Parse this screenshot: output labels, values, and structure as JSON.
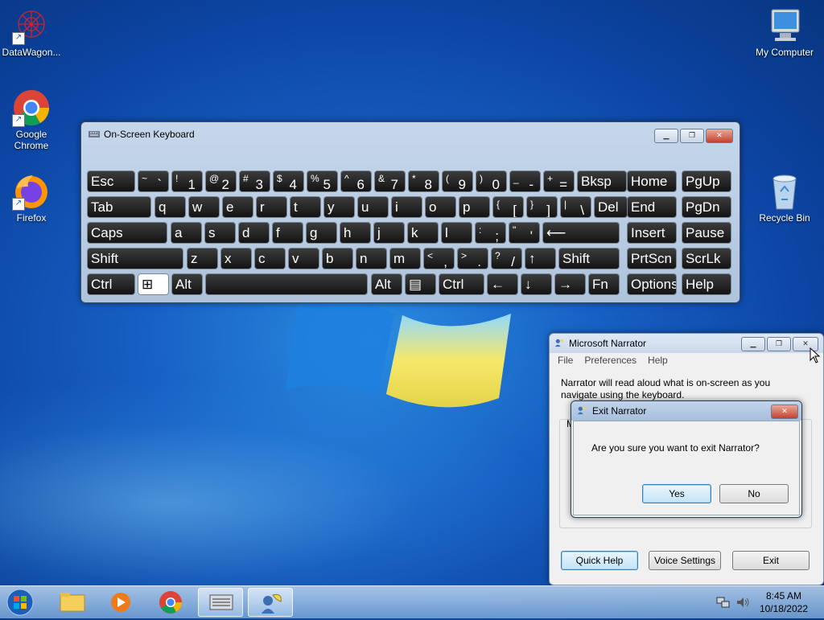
{
  "desktop": {
    "icons": [
      {
        "label": "DataWagon..."
      },
      {
        "label": "Google Chrome"
      },
      {
        "label": "Firefox"
      },
      {
        "label": "My Computer"
      },
      {
        "label": "Recycle Bin"
      }
    ]
  },
  "osk": {
    "title": "On-Screen Keyboard",
    "keys": {
      "esc": "Esc",
      "tab": "Tab",
      "caps": "Caps",
      "shift": "Shift",
      "ctrl": "Ctrl",
      "alt": "Alt",
      "bksp": "Bksp",
      "del": "Del",
      "shift_r": "Shift",
      "alt_r": "Alt",
      "ctrl_r": "Ctrl",
      "fn": "Fn",
      "home": "Home",
      "pgup": "PgUp",
      "end": "End",
      "pgdn": "PgDn",
      "insert": "Insert",
      "pause": "Pause",
      "prtscn": "PrtScn",
      "scrlk": "ScrLk",
      "options": "Options",
      "help": "Help"
    }
  },
  "narrator": {
    "title": "Microsoft Narrator",
    "menu": [
      "File",
      "Preferences",
      "Help"
    ],
    "body_text": "Narrator will read aloud what is on-screen as you navigate using the keyboard.",
    "group_letter": "M",
    "buttons": {
      "quick_help": "Quick Help",
      "voice_settings": "Voice Settings",
      "exit": "Exit"
    }
  },
  "exit_dialog": {
    "title": "Exit Narrator",
    "message": "Are you sure you want to exit Narrator?",
    "yes": "Yes",
    "no": "No"
  },
  "taskbar": {
    "time": "8:45 AM",
    "date": "10/18/2022"
  }
}
